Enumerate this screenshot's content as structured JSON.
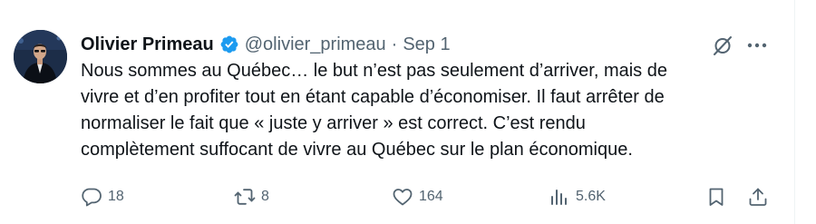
{
  "tweet": {
    "author_name": "Olivier Primeau",
    "handle": "@olivier_primeau",
    "separator": "·",
    "date": "Sep 1",
    "text_lines": [
      "Nous sommes au Québec… le but n’est pas seulement d’arriver, mais de",
      "vivre et d’en profiter tout en étant capable d’économiser. Il faut arrêter de",
      "normaliser le fait que « juste y arriver » est correct. C’est rendu",
      "complètement suffocant de vivre au Québec sur le plan économique."
    ]
  },
  "actions": {
    "replies": "18",
    "reposts": "8",
    "likes": "164",
    "views": "5.6K"
  },
  "icons": {
    "verified": "verified-badge-icon",
    "grok": "grok-icon",
    "more": "more-icon",
    "reply": "reply-icon",
    "repost": "repost-icon",
    "like": "like-icon",
    "views": "views-icon",
    "bookmark": "bookmark-icon",
    "share": "share-icon"
  },
  "colors": {
    "text": "#0f1419",
    "secondary": "#536471",
    "verified": "#1d9bf0"
  }
}
